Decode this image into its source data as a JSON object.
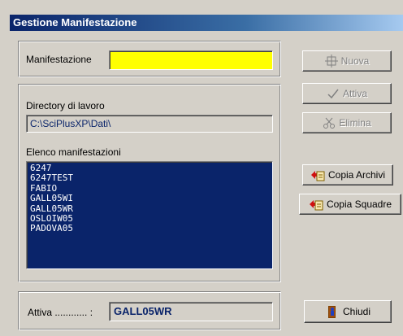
{
  "window": {
    "title": "Gestione Manifestazione"
  },
  "manifestazione": {
    "label": "Manifestazione",
    "value": ""
  },
  "directory": {
    "label": "Directory di lavoro",
    "value": "C:\\SciPlusXP\\Dati\\"
  },
  "elenco": {
    "label": "Elenco manifestazioni",
    "items": [
      "6247",
      "6247TEST",
      "FABIO",
      "GALL05WI",
      "GALL05WR",
      "OSLOIW05",
      "PADOVA05"
    ]
  },
  "attiva": {
    "label": "Attiva ............ :",
    "value": "GALL05WR"
  },
  "buttons": {
    "nuova": "Nuova",
    "attiva": "Attiva",
    "elimina": "Elimina",
    "copia_archivi": "Copia Archivi",
    "copia_squadre": "Copia Squadre",
    "chiudi": "Chiudi"
  },
  "colors": {
    "manifestazione_field_bg": "#ffff00",
    "list_bg": "#0a246a",
    "title_bar": "#0a246a"
  }
}
